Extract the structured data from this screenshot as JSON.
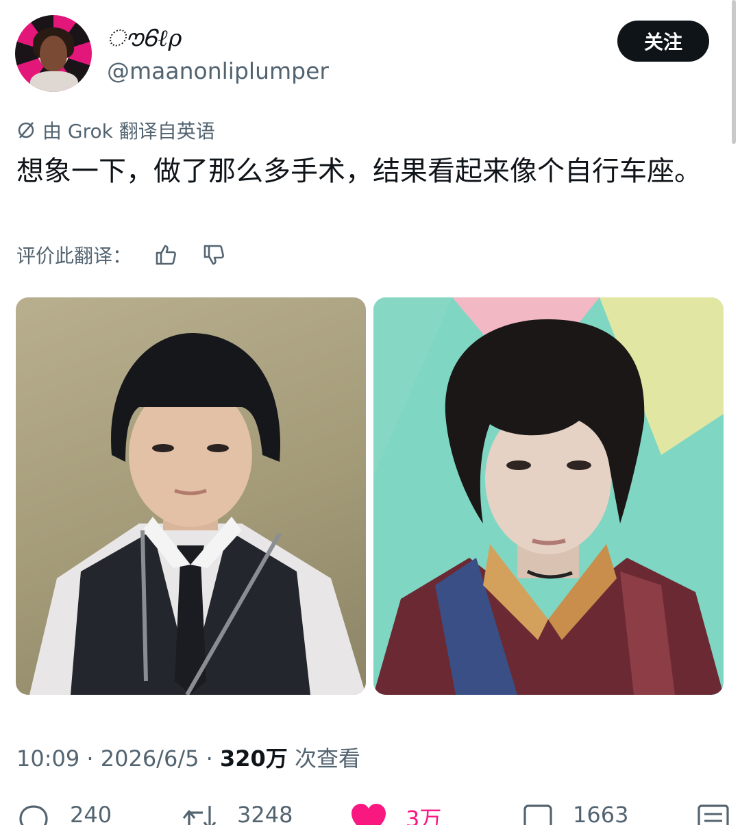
{
  "user": {
    "display_name": "ൗᏮℓρ",
    "handle": "@maanonliplumper",
    "follow_label": "关注"
  },
  "translation": {
    "note": "由 Grok 翻译自英语",
    "rate_label": "评价此翻译："
  },
  "tweet": {
    "text": "想象一下，做了那么多手术，结果看起来像个自行车座。"
  },
  "meta": {
    "time": "10:09",
    "date": "2026/6/5",
    "views": "320万",
    "views_suffix": "次查看"
  },
  "actions": {
    "replies": "240",
    "reposts": "3248",
    "likes": "3万",
    "bookmarks": "1663"
  },
  "colors": {
    "text": "#0f1419",
    "secondary": "#536471",
    "like": "#f91880"
  }
}
